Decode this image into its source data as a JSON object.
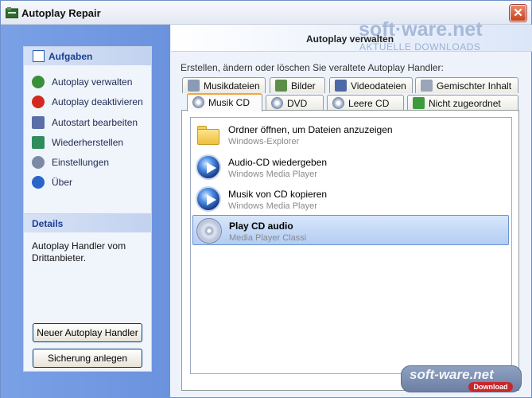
{
  "window": {
    "title": "Autoplay Repair",
    "close_glyph": "✕"
  },
  "watermark": {
    "top": "soft·ware.net",
    "top_sub": "AKTUELLE DOWNLOADS",
    "bottom": "soft-ware.net",
    "bottom_badge": "Download"
  },
  "sidebar": {
    "tasks_title": "Aufgaben",
    "tasks": [
      {
        "label": "Autoplay verwalten",
        "icon": "manage-icon",
        "color": "#3a8f3a"
      },
      {
        "label": "Autoplay deaktivieren",
        "icon": "disable-icon",
        "color": "#d22a1e"
      },
      {
        "label": "Autostart bearbeiten",
        "icon": "edit-icon",
        "color": "#5a6fa8"
      },
      {
        "label": "Wiederherstellen",
        "icon": "restore-icon",
        "color": "#2f8d5b"
      },
      {
        "label": "Einstellungen",
        "icon": "gear-icon",
        "color": "#7c8aa6"
      },
      {
        "label": "Über",
        "icon": "info-icon",
        "color": "#2a65c9"
      }
    ],
    "details_title": "Details",
    "details_text": "Autoplay Handler vom Drittanbieter.",
    "btn_new_handler": "Neuer Autoplay Handler",
    "btn_backup": "Sicherung anlegen"
  },
  "main": {
    "header_title": "Autoplay verwalten",
    "subtitle": "Erstellen, ändern oder löschen Sie veraltete Autoplay Handler:",
    "tabs_row1": [
      {
        "label": "Musikdateien",
        "icon": "music-file-icon"
      },
      {
        "label": "Bilder",
        "icon": "images-icon"
      },
      {
        "label": "Videodateien",
        "icon": "video-file-icon"
      },
      {
        "label": "Gemischter Inhalt",
        "icon": "mixed-content-icon"
      }
    ],
    "tabs_row2": [
      {
        "label": "Musik CD",
        "icon": "music-cd-icon",
        "active": true
      },
      {
        "label": "DVD",
        "icon": "dvd-icon"
      },
      {
        "label": "Leere CD",
        "icon": "blank-cd-icon"
      },
      {
        "label": "Nicht zugeordnet",
        "icon": "unassigned-icon"
      }
    ],
    "handlers": [
      {
        "title": "Ordner öffnen, um Dateien anzuzeigen",
        "sub": "Windows-Explorer",
        "icon": "folder-icon"
      },
      {
        "title": "Audio-CD wiedergeben",
        "sub": "Windows Media Player",
        "icon": "media-player-icon"
      },
      {
        "title": "Musik von CD kopieren",
        "sub": "Windows Media Player",
        "icon": "media-player-icon"
      },
      {
        "title": "Play CD audio",
        "sub": "Media Player Classi",
        "icon": "cd-audio-icon",
        "selected": true
      }
    ]
  }
}
